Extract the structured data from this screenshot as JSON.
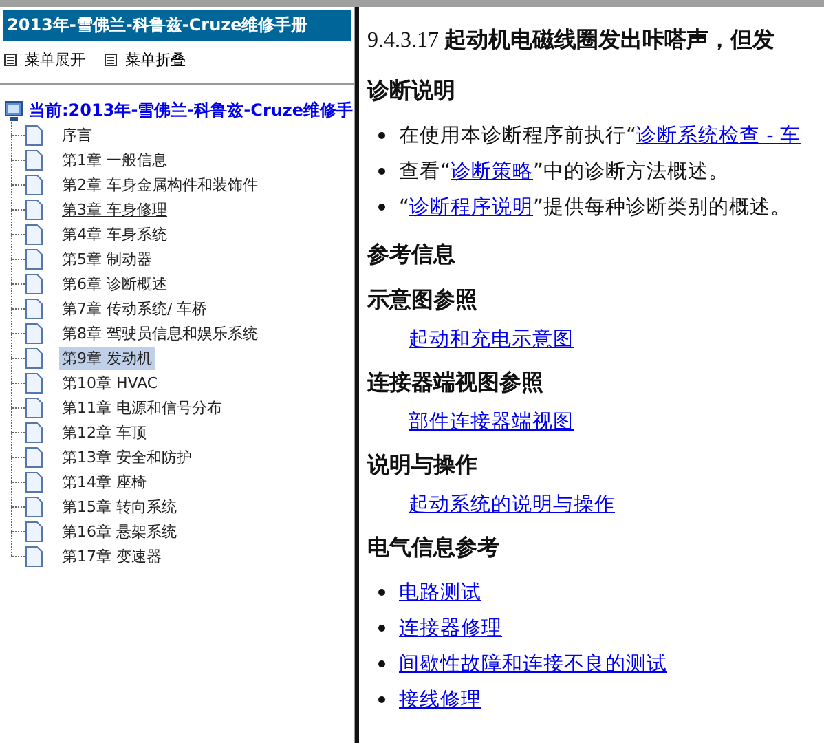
{
  "sidebar": {
    "header": "2013年-雪佛兰-科鲁兹-Cruze维修手册",
    "menu_actions": [
      "菜单展开",
      "菜单折叠"
    ],
    "tree": {
      "label": "当前:2013年-雪佛兰-科鲁兹-Cruze维修手",
      "children": [
        {
          "label": "序言",
          "selected": false,
          "underlined": false
        },
        {
          "label": "第1章 一般信息",
          "selected": false,
          "underlined": false
        },
        {
          "label": "第2章 车身金属构件和装饰件",
          "selected": false,
          "underlined": false
        },
        {
          "label": "第3章 车身修理",
          "selected": false,
          "underlined": true
        },
        {
          "label": "第4章 车身系统",
          "selected": false,
          "underlined": false
        },
        {
          "label": "第5章 制动器",
          "selected": false,
          "underlined": false
        },
        {
          "label": "第6章 诊断概述",
          "selected": false,
          "underlined": false
        },
        {
          "label": "第7章 传动系统/ 车桥",
          "selected": false,
          "underlined": false
        },
        {
          "label": "第8章 驾驶员信息和娱乐系统",
          "selected": false,
          "underlined": false
        },
        {
          "label": "第9章 发动机",
          "selected": true,
          "underlined": false
        },
        {
          "label": "第10章 HVAC",
          "selected": false,
          "underlined": false
        },
        {
          "label": "第11章 电源和信号分布",
          "selected": false,
          "underlined": false
        },
        {
          "label": "第12章 车顶",
          "selected": false,
          "underlined": false
        },
        {
          "label": "第13章 安全和防护",
          "selected": false,
          "underlined": false
        },
        {
          "label": "第14章 座椅",
          "selected": false,
          "underlined": false
        },
        {
          "label": "第15章 转向系统",
          "selected": false,
          "underlined": false
        },
        {
          "label": "第16章 悬架系统",
          "selected": false,
          "underlined": false
        },
        {
          "label": "第17章 变速器",
          "selected": false,
          "underlined": false
        }
      ]
    }
  },
  "content": {
    "title_number": "9.4.3.17",
    "title": "起动机电磁线圈发出咔嗒声，但发",
    "blocks": [
      {
        "kind": "heading",
        "text": "诊断说明"
      },
      {
        "kind": "bullet",
        "before": "在使用本诊断程序前执行“",
        "link": "诊断系统检查 - 车"
      },
      {
        "kind": "bullet",
        "before": "查看“",
        "link": "诊断策略",
        "after": "”中的诊断方法概述。"
      },
      {
        "kind": "bullet",
        "before": "“",
        "link": "诊断程序说明",
        "after": "”提供每种诊断类别的概述。"
      },
      {
        "kind": "heading",
        "text": "参考信息"
      },
      {
        "kind": "heading",
        "text": "示意图参照"
      },
      {
        "kind": "indent_link",
        "link": "起动和充电示意图"
      },
      {
        "kind": "heading",
        "text": "连接器端视图参照"
      },
      {
        "kind": "indent_link",
        "link": "部件连接器端视图"
      },
      {
        "kind": "heading",
        "text": "说明与操作"
      },
      {
        "kind": "indent_link",
        "link": "起动系统的说明与操作"
      },
      {
        "kind": "heading",
        "text": "电气信息参考"
      },
      {
        "kind": "bullet",
        "link": "电路测试"
      },
      {
        "kind": "bullet",
        "link": "连接器修理"
      },
      {
        "kind": "bullet",
        "link": "间歇性故障和连接不良的测试"
      },
      {
        "kind": "bullet",
        "link": "接线修理"
      }
    ]
  }
}
